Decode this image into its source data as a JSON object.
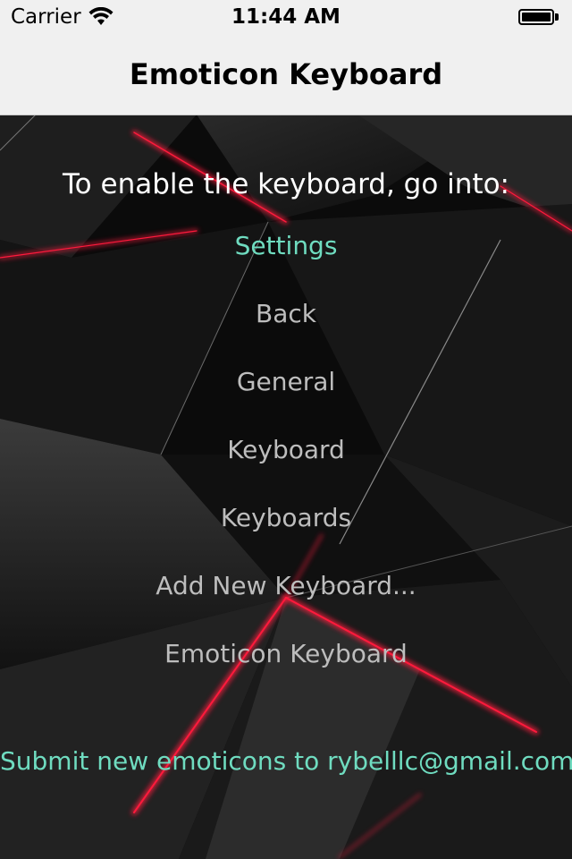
{
  "status_bar": {
    "carrier": "Carrier",
    "time": "11:44 AM",
    "battery_level": 1.0
  },
  "nav": {
    "title": "Emoticon Keyboard"
  },
  "main": {
    "intro": "To enable the keyboard, go into:",
    "steps": [
      {
        "label": "Settings"
      },
      {
        "label": "Back"
      },
      {
        "label": "General"
      },
      {
        "label": "Keyboard"
      },
      {
        "label": "Keyboards"
      },
      {
        "label": "Add New Keyboard..."
      },
      {
        "label": "Emoticon Keyboard"
      }
    ],
    "submit": "Submit new emoticons to rybelllc@gmail.com"
  },
  "colors": {
    "accent": "#6fdcc0",
    "step_text": "#bdbdbd",
    "highlight_red": "#ff1a3c"
  },
  "icons": [
    "wifi-icon",
    "battery-icon"
  ]
}
